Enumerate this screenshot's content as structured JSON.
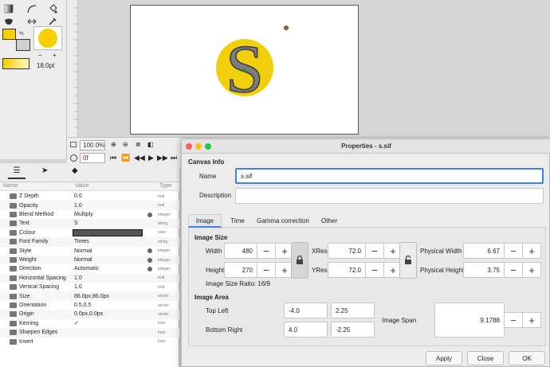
{
  "toolbox": {
    "outline_color": "#f5d000",
    "fill_color": "#f5d000",
    "brush_size": "18.0pt",
    "zoom_minus": "−",
    "zoom_plus": "+"
  },
  "canvas_toolbar": {
    "zoom": "100.0%",
    "frame": "0f"
  },
  "params": {
    "col_name": "Name",
    "col_value": "Value",
    "col_type": "Type",
    "rows": [
      {
        "name": "Z Depth",
        "value": "0.0",
        "type": "real",
        "dot": false
      },
      {
        "name": "Opacity",
        "value": "1.0",
        "type": "real",
        "dot": false
      },
      {
        "name": "Blend Method",
        "value": "Multiply",
        "type": "integer",
        "dot": true
      },
      {
        "name": "Text",
        "value": "S",
        "type": "string",
        "dot": false
      },
      {
        "name": "Colour",
        "value": "",
        "type": "color",
        "dot": false
      },
      {
        "name": "Font Family",
        "value": "Times",
        "type": "string",
        "dot": false
      },
      {
        "name": "Style",
        "value": "Normal",
        "type": "integer",
        "dot": true
      },
      {
        "name": "Weight",
        "value": "Normal",
        "type": "integer",
        "dot": true
      },
      {
        "name": "Direction",
        "value": "Automatic",
        "type": "integer",
        "dot": true
      },
      {
        "name": "Horizontal Spacing",
        "value": "1.0",
        "type": "real",
        "dot": false
      },
      {
        "name": "Vertical Spacing",
        "value": "1.0",
        "type": "real",
        "dot": false
      },
      {
        "name": "Size",
        "value": "86.0px,86.0px",
        "type": "vector",
        "dot": false
      },
      {
        "name": "Orientation",
        "value": "0.5,0.5",
        "type": "vector",
        "dot": false
      },
      {
        "name": "Origin",
        "value": "0.0px,0.0px",
        "type": "vector",
        "dot": false
      },
      {
        "name": "Kerning",
        "value": "✓",
        "type": "bool",
        "dot": false
      },
      {
        "name": "Sharpen Edges",
        "value": "",
        "type": "bool",
        "dot": false
      },
      {
        "name": "Invert",
        "value": "",
        "type": "bool",
        "dot": false
      }
    ]
  },
  "dialog": {
    "title": "Properties - s.sif",
    "section_canvas_info": "Canvas Info",
    "name_label": "Name",
    "name_value": "s.sif",
    "description_label": "Description",
    "description_value": "",
    "tabs": [
      "Image",
      "Time",
      "Gamma correction",
      "Other"
    ],
    "section_image_size": "Image Size",
    "width_label": "Width",
    "width_value": "480",
    "height_label": "Height",
    "height_value": "270",
    "xres_label": "XRes",
    "xres_value": "72.0",
    "yres_label": "YRes",
    "yres_value": "72.0",
    "phys_width_label": "Physical Width",
    "phys_width_value": "6.67",
    "phys_height_label": "Physical Height",
    "phys_height_value": "3.75",
    "ratio_text": "Image Size Ratio: 16/9",
    "section_image_area": "Image Area",
    "top_left_label": "Top Left",
    "top_left_x": "-4.0",
    "top_left_y": "2.25",
    "bottom_right_label": "Bottom Right",
    "bottom_right_x": "4.0",
    "bottom_right_y": "-2.25",
    "image_span_label": "Image Span",
    "image_span_value": "9.1788",
    "minus": "−",
    "plus": "+",
    "apply_label": "Apply",
    "close_label": "Close",
    "ok_label": "OK"
  }
}
